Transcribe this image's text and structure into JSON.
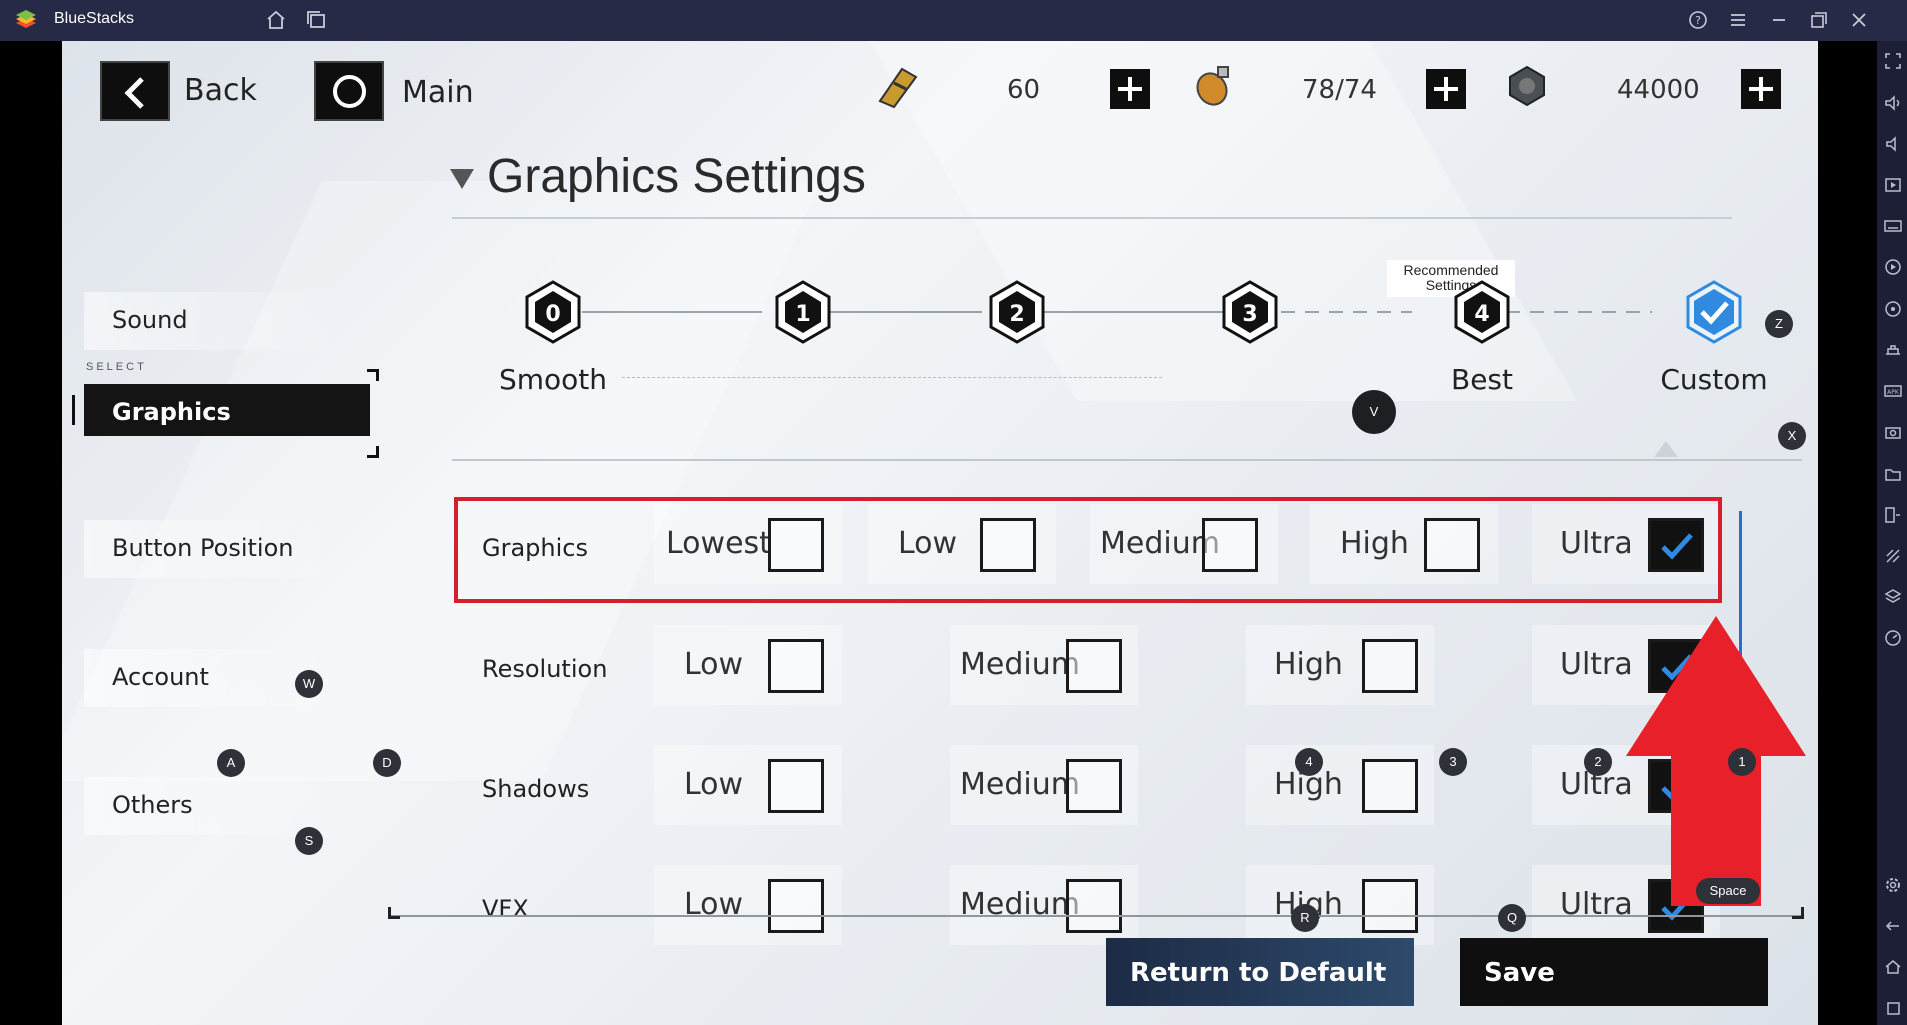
{
  "window": {
    "title": "BlueStacks"
  },
  "nav": {
    "back_label": "Back",
    "main_label": "Main"
  },
  "resources": [
    {
      "icon": "ticket-icon",
      "value": "60"
    },
    {
      "icon": "fuel-can-icon",
      "value": "78/74"
    },
    {
      "icon": "coin-icon",
      "value": "44000"
    }
  ],
  "section_title": "Graphics Settings",
  "left_menu": {
    "select_label": "SELECT",
    "items": [
      {
        "label": "Sound"
      },
      {
        "label": "Graphics"
      },
      {
        "label": "Button Position"
      },
      {
        "label": "Account"
      },
      {
        "label": "Others"
      }
    ]
  },
  "presets": {
    "recommended_label": "Recommended Settings",
    "items": [
      {
        "number": "0",
        "label": "Smooth"
      },
      {
        "number": "1",
        "label": ""
      },
      {
        "number": "2",
        "label": ""
      },
      {
        "number": "3",
        "label": ""
      },
      {
        "number": "4",
        "label": "Best"
      },
      {
        "number": "",
        "label": "Custom"
      }
    ]
  },
  "rows": [
    {
      "label": "Graphics",
      "options": [
        "Lowest",
        "Low",
        "Medium",
        "High",
        "Ultra"
      ],
      "selected": "Ultra"
    },
    {
      "label": "Resolution",
      "options": [
        "Low",
        "Medium",
        "High",
        "Ultra"
      ],
      "selected": "Ultra"
    },
    {
      "label": "Shadows",
      "options": [
        "Low",
        "Medium",
        "High",
        "Ultra"
      ],
      "selected": "Ultra"
    },
    {
      "label": "VFX",
      "options": [
        "Low",
        "Medium",
        "High",
        "Ultra"
      ],
      "selected": "Ultra"
    }
  ],
  "key_hints": {
    "z": "Z",
    "x": "X",
    "v": "V",
    "w": "W",
    "a": "A",
    "s": "S",
    "d": "D",
    "four": "4",
    "three": "3",
    "two": "2",
    "one": "1",
    "r": "R",
    "q": "Q",
    "space": "Space"
  },
  "buttons": {
    "return_default": "Return to Default",
    "save": "Save"
  },
  "colors": {
    "highlight": "#d4202c",
    "arrow": "#e8202a",
    "check_blue": "#2f8ae0",
    "topbar": "#262a46"
  }
}
